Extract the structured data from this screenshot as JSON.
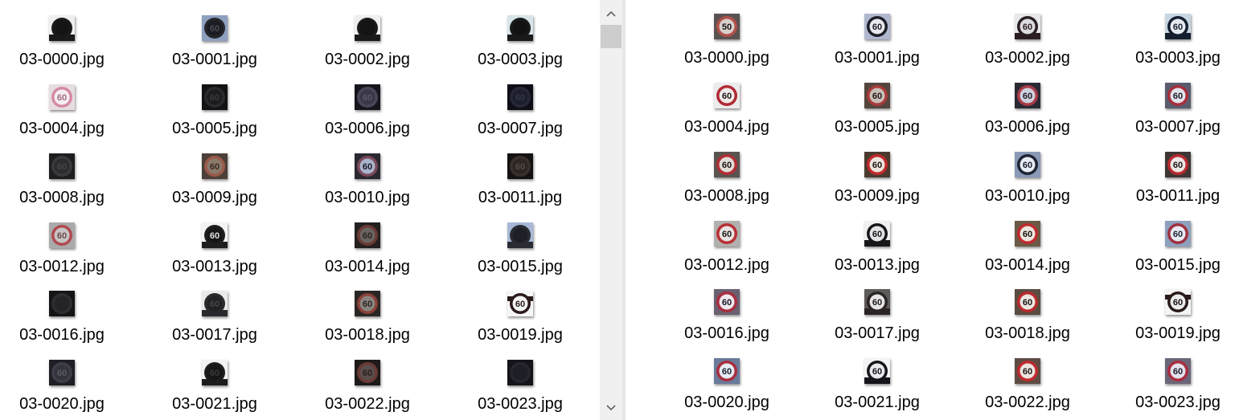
{
  "left_pane": {
    "items": [
      {
        "name": "03-0000.jpg",
        "bg": "#efefef",
        "sign": "#151515",
        "ring": "#1a1a1a",
        "text": "#151515",
        "digits": "",
        "style": "post"
      },
      {
        "name": "03-0001.jpg",
        "bg": "#8ea0bf",
        "sign": "#1a1c22",
        "ring": "#25262b",
        "text": "#4a4c55",
        "digits": "60",
        "style": "circle"
      },
      {
        "name": "03-0002.jpg",
        "bg": "#efefef",
        "sign": "#141414",
        "ring": "#1a1a1a",
        "text": "#141414",
        "digits": "",
        "style": "post"
      },
      {
        "name": "03-0003.jpg",
        "bg": "#d8e4ea",
        "sign": "#121212",
        "ring": "#1a1a1a",
        "text": "#121212",
        "digits": "",
        "style": "post"
      },
      {
        "name": "03-0004.jpg",
        "bg": "#e6dde2",
        "sign": "#f4eef2",
        "ring": "#d68aa4",
        "text": "#a06a80",
        "digits": "60",
        "style": "circle"
      },
      {
        "name": "03-0005.jpg",
        "bg": "#121214",
        "sign": "#1c1c20",
        "ring": "#2a2a2e",
        "text": "#3a3a3e",
        "digits": "60",
        "style": "circle"
      },
      {
        "name": "03-0006.jpg",
        "bg": "#16161c",
        "sign": "#3a3848",
        "ring": "#4a4658",
        "text": "#5a5868",
        "digits": "60",
        "style": "circle"
      },
      {
        "name": "03-0007.jpg",
        "bg": "#0e0e16",
        "sign": "#1c1e2e",
        "ring": "#262838",
        "text": "#34364a",
        "digits": "60",
        "style": "circle"
      },
      {
        "name": "03-0008.jpg",
        "bg": "#1e1e20",
        "sign": "#2c2c2e",
        "ring": "#3a3a3c",
        "text": "#46464a",
        "digits": "60",
        "style": "circle"
      },
      {
        "name": "03-0009.jpg",
        "bg": "#4c4038",
        "sign": "#8a7a6c",
        "ring": "#9a5a4a",
        "text": "#3a2a22",
        "digits": "60",
        "style": "circle"
      },
      {
        "name": "03-0010.jpg",
        "bg": "#2a2830",
        "sign": "#aab4cc",
        "ring": "#7a4a5a",
        "text": "#1a1a2a",
        "digits": "60",
        "style": "circle"
      },
      {
        "name": "03-0011.jpg",
        "bg": "#141212",
        "sign": "#2c2624",
        "ring": "#3a302c",
        "text": "#5a4a44",
        "digits": "60",
        "style": "circle"
      },
      {
        "name": "03-0012.jpg",
        "bg": "#aaaaaa",
        "sign": "#c8c4c4",
        "ring": "#b04a50",
        "text": "#6a4a4a",
        "digits": "60",
        "style": "circle"
      },
      {
        "name": "03-0013.jpg",
        "bg": "#f4f4f4",
        "sign": "#161616",
        "ring": "#1e1e1e",
        "text": "#e0e0e0",
        "digits": "60",
        "style": "post"
      },
      {
        "name": "03-0014.jpg",
        "bg": "#242020",
        "sign": "#6a6460",
        "ring": "#6a3a34",
        "text": "#2a2422",
        "digits": "60",
        "style": "circle"
      },
      {
        "name": "03-0015.jpg",
        "bg": "#a8b8d6",
        "sign": "#1e2028",
        "ring": "#2a2c34",
        "text": "#3a3c46",
        "digits": "",
        "style": "post"
      },
      {
        "name": "03-0016.jpg",
        "bg": "#141416",
        "sign": "#242428",
        "ring": "#2e2e32",
        "text": "#3a3a40",
        "digits": "",
        "style": "circle"
      },
      {
        "name": "03-0017.jpg",
        "bg": "#eaeaea",
        "sign": "#222226",
        "ring": "#2a2a2e",
        "text": "#44444a",
        "digits": "60",
        "style": "post"
      },
      {
        "name": "03-0018.jpg",
        "bg": "#2a2624",
        "sign": "#8a8480",
        "ring": "#8a4038",
        "text": "#2a2422",
        "digits": "60",
        "style": "circle"
      },
      {
        "name": "03-0019.jpg",
        "bg": "#f6f6f6",
        "sign": "#f2f2f2",
        "ring": "#2a1a1a",
        "text": "#2a1a1a",
        "digits": "60",
        "style": "bar"
      },
      {
        "name": "03-0020.jpg",
        "bg": "#1e1e24",
        "sign": "#34343c",
        "ring": "#3e3e48",
        "text": "#5a5a66",
        "digits": "60",
        "style": "circle"
      },
      {
        "name": "03-0021.jpg",
        "bg": "#f2f2f2",
        "sign": "#161616",
        "ring": "#1c1c1c",
        "text": "#3a3a3a",
        "digits": "60",
        "style": "post"
      },
      {
        "name": "03-0022.jpg",
        "bg": "#1e1a1a",
        "sign": "#5a4e4c",
        "ring": "#6a3a36",
        "text": "#2a2020",
        "digits": "60",
        "style": "circle"
      },
      {
        "name": "03-0023.jpg",
        "bg": "#14141a",
        "sign": "#1e1e26",
        "ring": "#26262e",
        "text": "#2e2e36",
        "digits": "",
        "style": "circle"
      }
    ]
  },
  "right_pane": {
    "items": [
      {
        "name": "03-0000.jpg",
        "bg": "#5a5250",
        "sign": "#d8d0cc",
        "ring": "#b0504a",
        "text": "#1a1414",
        "digits": "50",
        "style": "circle"
      },
      {
        "name": "03-0001.jpg",
        "bg": "#b0b8d0",
        "sign": "#e8e8ee",
        "ring": "#1e1e28",
        "text": "#1e1e28",
        "digits": "60",
        "style": "circle"
      },
      {
        "name": "03-0002.jpg",
        "bg": "#e8e8ea",
        "sign": "#dcdce0",
        "ring": "#2a1e22",
        "text": "#2a1e22",
        "digits": "60",
        "style": "post"
      },
      {
        "name": "03-0003.jpg",
        "bg": "#c8d6e2",
        "sign": "#e6eaf0",
        "ring": "#141e2e",
        "text": "#141e2e",
        "digits": "60",
        "style": "post"
      },
      {
        "name": "03-0004.jpg",
        "bg": "#ececec",
        "sign": "#f0eaea",
        "ring": "#b02a34",
        "text": "#1a1414",
        "digits": "60",
        "style": "circle"
      },
      {
        "name": "03-0005.jpg",
        "bg": "#54463e",
        "sign": "#c8beb6",
        "ring": "#a83a3a",
        "text": "#1e1818",
        "digits": "60",
        "style": "circle"
      },
      {
        "name": "03-0006.jpg",
        "bg": "#2a2a34",
        "sign": "#d0d0dc",
        "ring": "#a83a48",
        "text": "#1e1e28",
        "digits": "60",
        "style": "circle"
      },
      {
        "name": "03-0007.jpg",
        "bg": "#5a5c6e",
        "sign": "#e2e2ea",
        "ring": "#a82e3c",
        "text": "#1a1a24",
        "digits": "60",
        "style": "circle"
      },
      {
        "name": "03-0008.jpg",
        "bg": "#5a5450",
        "sign": "#e0dcd8",
        "ring": "#b02e34",
        "text": "#181414",
        "digits": "60",
        "style": "circle"
      },
      {
        "name": "03-0009.jpg",
        "bg": "#4a3a2e",
        "sign": "#ece4dc",
        "ring": "#c0282c",
        "text": "#1a1414",
        "digits": "60",
        "style": "circle"
      },
      {
        "name": "03-0010.jpg",
        "bg": "#8a9ab6",
        "sign": "#e6ecf4",
        "ring": "#1e2434",
        "text": "#1a1e2a",
        "digits": "60",
        "style": "circle"
      },
      {
        "name": "03-0011.jpg",
        "bg": "#3e3634",
        "sign": "#ece6e4",
        "ring": "#b82a30",
        "text": "#1a1414",
        "digits": "60",
        "style": "circle"
      },
      {
        "name": "03-0012.jpg",
        "bg": "#b2b0ae",
        "sign": "#e8e4e2",
        "ring": "#b83034",
        "text": "#1a1616",
        "digits": "60",
        "style": "circle"
      },
      {
        "name": "03-0013.jpg",
        "bg": "#f0f0f0",
        "sign": "#e4e4e8",
        "ring": "#16161a",
        "text": "#16161a",
        "digits": "60",
        "style": "post"
      },
      {
        "name": "03-0014.jpg",
        "bg": "#6a5a46",
        "sign": "#ece6de",
        "ring": "#c02a2e",
        "text": "#1a1414",
        "digits": "60",
        "style": "circle"
      },
      {
        "name": "03-0015.jpg",
        "bg": "#8ea0be",
        "sign": "#e6eaf2",
        "ring": "#a03040",
        "text": "#1e2230",
        "digits": "60",
        "style": "circle"
      },
      {
        "name": "03-0016.jpg",
        "bg": "#6a6070",
        "sign": "#ece8ee",
        "ring": "#a82e3e",
        "text": "#1a1620",
        "digits": "60",
        "style": "circle"
      },
      {
        "name": "03-0017.jpg",
        "bg": "#5e5a58",
        "sign": "#e6e4e4",
        "ring": "#2a2424",
        "text": "#1e1a1a",
        "digits": "60",
        "style": "post"
      },
      {
        "name": "03-0018.jpg",
        "bg": "#5a4c40",
        "sign": "#ece6e0",
        "ring": "#b82a2e",
        "text": "#1a1414",
        "digits": "60",
        "style": "circle"
      },
      {
        "name": "03-0019.jpg",
        "bg": "#f4f4f4",
        "sign": "#ececec",
        "ring": "#2a1a1a",
        "text": "#1a1010",
        "digits": "60",
        "style": "bar"
      },
      {
        "name": "03-0020.jpg",
        "bg": "#6a7a9a",
        "sign": "#e6eaf2",
        "ring": "#a82e40",
        "text": "#1a1e2a",
        "digits": "60",
        "style": "circle"
      },
      {
        "name": "03-0021.jpg",
        "bg": "#f4f4f4",
        "sign": "#e8e8ec",
        "ring": "#14141a",
        "text": "#14141a",
        "digits": "60",
        "style": "post"
      },
      {
        "name": "03-0022.jpg",
        "bg": "#5e4c44",
        "sign": "#ece4e0",
        "ring": "#c02a2e",
        "text": "#1a1414",
        "digits": "60",
        "style": "circle"
      },
      {
        "name": "03-0023.jpg",
        "bg": "#6a6678",
        "sign": "#e4e2ec",
        "ring": "#a82e40",
        "text": "#1a1824",
        "digits": "60",
        "style": "circle"
      }
    ]
  },
  "scrollbar": {
    "up_icon": "chevron-up-icon",
    "down_icon": "chevron-down-icon",
    "thumb_color": "#cdcdcd",
    "track_color": "#f0f0f0"
  }
}
